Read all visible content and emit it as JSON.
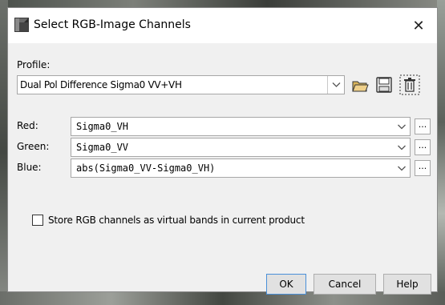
{
  "window": {
    "title": "Select RGB-Image Channels",
    "close_symbol": "✕"
  },
  "profile": {
    "label": "Profile:",
    "selected": "Dual Pol Difference Sigma0 VV+VH",
    "icons": [
      "open-folder-icon",
      "save-disk-icon",
      "delete-trash-icon"
    ]
  },
  "channels": [
    {
      "label": "Red:",
      "expression": "Sigma0_VH"
    },
    {
      "label": "Green:",
      "expression": "Sigma0_VV"
    },
    {
      "label": "Blue:",
      "expression": "abs(Sigma0_VV-Sigma0_VH)"
    }
  ],
  "expression_button_label": "...",
  "virtual_bands": {
    "label": "Store RGB channels as virtual bands in current product",
    "checked": false
  },
  "buttons": {
    "ok": "OK",
    "cancel": "Cancel",
    "help": "Help"
  }
}
